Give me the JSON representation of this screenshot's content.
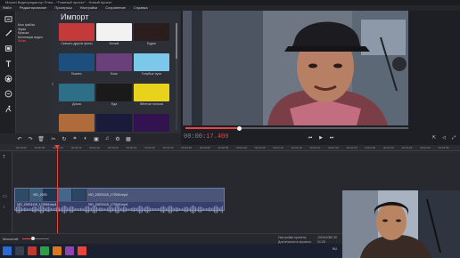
{
  "window": {
    "title": "Movavi Видеоредактор Плюс - *Главный проект* - Новый проект"
  },
  "menu": [
    "Файл",
    "Редактирование",
    "Проигрыш",
    "Настройки",
    "Сохранение",
    "Справка"
  ],
  "import_panel": {
    "title": "Импорт",
    "categories": [
      {
        "label": "Мои файлы",
        "selected": false
      },
      {
        "label": "Звуки",
        "selected": false
      },
      {
        "label": "Музыка",
        "selected": false
      },
      {
        "label": "Коллекция видео",
        "selected": false
      },
      {
        "label": "Фоны",
        "selected": true
      }
    ],
    "thumbnails": [
      {
        "label": "Скачать другие фоны",
        "color": "#c43a3a"
      },
      {
        "label": "Белый",
        "color": "#f2f2f2"
      },
      {
        "label": "Будни",
        "color": "#2b1d1d"
      },
      {
        "label": "Бизнес",
        "color": "#1d4f7e"
      },
      {
        "label": "Боке",
        "color": "#6b3f7b"
      },
      {
        "label": "Голубые лучи",
        "color": "#7cc8ea"
      },
      {
        "label": "Доска",
        "color": "#2c6f86"
      },
      {
        "label": "Еда",
        "color": "#1a1a1a"
      },
      {
        "label": "Жёлтые полосы",
        "color": "#e8d21c"
      },
      {
        "label": "",
        "color": "#b06b3a"
      },
      {
        "label": "",
        "color": "#1a1a3a"
      },
      {
        "label": "",
        "color": "#33134f"
      }
    ]
  },
  "preview": {
    "timecode_main": "00:00:",
    "timecode_ms": "17.400",
    "progress": 0.24
  },
  "timeline": {
    "ruler_ticks": [
      "00:00:00",
      "00:00:05",
      "00:00:10",
      "00:00:15",
      "00:00:20",
      "00:00:25",
      "00:00:30",
      "00:00:35",
      "00:00:40",
      "00:00:45",
      "00:00:50",
      "00:00:55",
      "00:01:00",
      "00:01:05",
      "00:01:10",
      "00:01:15",
      "00:01:20",
      "00:01:25",
      "00:01:30",
      "00:01:35",
      "00:01:40",
      "00:01:45",
      "00:01:50",
      "00:01:55"
    ],
    "clip_video_1": "VID_2020",
    "clip_video_2": "VID_20201115_173916.mp4",
    "clip_audio": "VID_20201115_173916.mp4",
    "clip_audio_2": "VID_20201115_173916.mp4"
  },
  "status": {
    "scale_label": "Масштаб:",
    "scale_value": 0.4,
    "project_settings_label": "Настройки проекта:",
    "project_settings_value": "1920х1080 30",
    "duration_label": "Длительность проекта:",
    "duration_value": "01:28"
  },
  "taskbar": {
    "tray": "RU"
  },
  "colors": {
    "accent": "#e8453c",
    "clip": "#4a5578",
    "panel": "#2d2f36"
  }
}
